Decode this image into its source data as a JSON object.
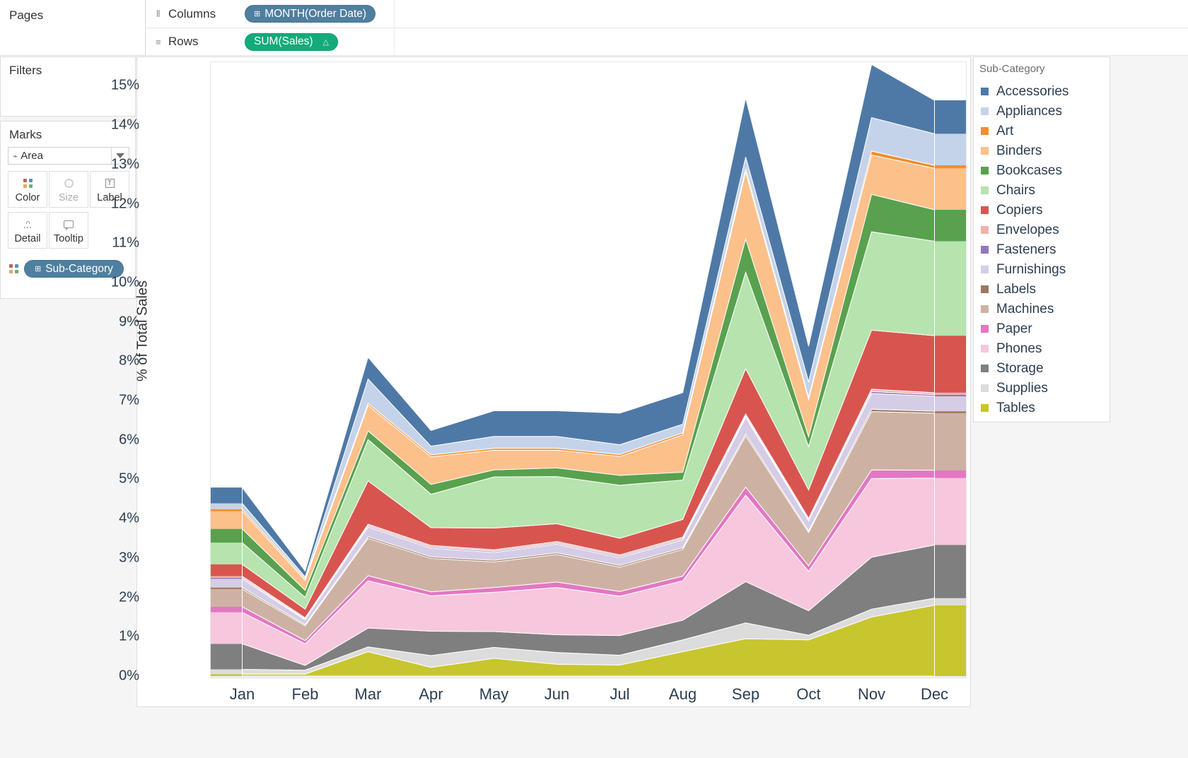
{
  "shelves": {
    "pages_label": "Pages",
    "columns_label": "Columns",
    "rows_label": "Rows",
    "columns_icon": "columns-grid-icon",
    "rows_icon": "rows-list-icon",
    "columns_pill": "MONTH(Order Date)",
    "rows_pill": "SUM(Sales)",
    "pill_dim_glyph": "⊞",
    "rows_sort_glyph": "△"
  },
  "filters": {
    "title": "Filters"
  },
  "marks": {
    "title": "Marks",
    "mark_type": "Area",
    "mark_type_icon": "area-chart-icon",
    "buttons": [
      {
        "label": "Color",
        "icon": "color-dots-icon",
        "disabled": false
      },
      {
        "label": "Size",
        "icon": "size-circle-icon",
        "disabled": true
      },
      {
        "label": "Label",
        "icon": "label-text-icon",
        "disabled": false
      },
      {
        "label": "Detail",
        "icon": "detail-dots-icon",
        "disabled": false
      },
      {
        "label": "Tooltip",
        "icon": "tooltip-bubble-icon",
        "disabled": false
      }
    ],
    "color_pill": "Sub-Category"
  },
  "legend": {
    "title": "Sub-Category",
    "items": [
      {
        "label": "Accessories",
        "color": "#4e79a7"
      },
      {
        "label": "Appliances",
        "color": "#c5d3ea"
      },
      {
        "label": "Art",
        "color": "#f28e2b"
      },
      {
        "label": "Binders",
        "color": "#fcc08b"
      },
      {
        "label": "Bookcases",
        "color": "#59a14f"
      },
      {
        "label": "Chairs",
        "color": "#b6e3ae"
      },
      {
        "label": "Copiers",
        "color": "#d8554f"
      },
      {
        "label": "Envelopes",
        "color": "#f5b0ab"
      },
      {
        "label": "Fasteners",
        "color": "#9275bd"
      },
      {
        "label": "Furnishings",
        "color": "#d5cde6"
      },
      {
        "label": "Labels",
        "color": "#9d7660"
      },
      {
        "label": "Machines",
        "color": "#cdb2a4"
      },
      {
        "label": "Paper",
        "color": "#e377c2"
      },
      {
        "label": "Phones",
        "color": "#f7c7dd"
      },
      {
        "label": "Storage",
        "color": "#7f7f7f"
      },
      {
        "label": "Supplies",
        "color": "#dcdcdc"
      },
      {
        "label": "Tables",
        "color": "#c7c62f"
      }
    ]
  },
  "chart_data": {
    "type": "area",
    "title": "",
    "xlabel": "",
    "ylabel": "% of Total Sales",
    "ylim": [
      0,
      15.6
    ],
    "ytick_step": 1,
    "ytick_labels": [
      "15%",
      "14%",
      "13%",
      "12%",
      "11%",
      "10%",
      "9%",
      "8%",
      "7%",
      "6%",
      "5%",
      "4%",
      "3%",
      "2%",
      "1%",
      "0%"
    ],
    "categories": [
      "Jan",
      "Feb",
      "Mar",
      "Apr",
      "May",
      "Jun",
      "Jul",
      "Aug",
      "Sep",
      "Oct",
      "Nov",
      "Dec"
    ],
    "stacked": true,
    "grid": false,
    "legend_position": "right",
    "totals": [
      4.1,
      2.55,
      8.65,
      6.0,
      6.4,
      6.35,
      6.45,
      6.95,
      13.45,
      8.35,
      15.2,
      14.2
    ],
    "series": [
      {
        "name": "Tables",
        "color": "#c7c62f",
        "values": [
          0.05,
          0.05,
          0.62,
          0.22,
          0.45,
          0.3,
          0.28,
          0.62,
          0.95,
          0.92,
          1.5,
          1.8
        ]
      },
      {
        "name": "Supplies",
        "color": "#dcdcdc",
        "values": [
          0.12,
          0.1,
          0.12,
          0.3,
          0.28,
          0.3,
          0.25,
          0.3,
          0.4,
          0.12,
          0.2,
          0.18
        ]
      },
      {
        "name": "Storage",
        "color": "#7f7f7f",
        "values": [
          0.65,
          0.12,
          0.48,
          0.62,
          0.4,
          0.45,
          0.5,
          0.5,
          1.05,
          0.62,
          1.32,
          1.35
        ]
      },
      {
        "name": "Phones",
        "color": "#f7c7dd",
        "values": [
          0.8,
          0.55,
          1.2,
          0.9,
          1.0,
          1.2,
          1.0,
          1.0,
          2.2,
          1.0,
          2.0,
          1.7
        ]
      },
      {
        "name": "Paper",
        "color": "#e377c2",
        "values": [
          0.14,
          0.08,
          0.13,
          0.1,
          0.12,
          0.14,
          0.12,
          0.12,
          0.2,
          0.14,
          0.22,
          0.2
        ]
      },
      {
        "name": "Machines",
        "color": "#cdb2a4",
        "values": [
          0.45,
          0.38,
          0.95,
          0.85,
          0.65,
          0.7,
          0.62,
          0.68,
          1.3,
          0.85,
          1.48,
          1.45
        ]
      },
      {
        "name": "Labels",
        "color": "#9d7660",
        "values": [
          0.04,
          0.03,
          0.04,
          0.04,
          0.04,
          0.04,
          0.04,
          0.04,
          0.05,
          0.04,
          0.06,
          0.05
        ]
      },
      {
        "name": "Furnishings",
        "color": "#d5cde6",
        "values": [
          0.22,
          0.12,
          0.25,
          0.22,
          0.2,
          0.22,
          0.2,
          0.2,
          0.42,
          0.25,
          0.4,
          0.38
        ]
      },
      {
        "name": "Fasteners",
        "color": "#9275bd",
        "values": [
          0.03,
          0.02,
          0.03,
          0.03,
          0.03,
          0.03,
          0.03,
          0.03,
          0.04,
          0.03,
          0.05,
          0.04
        ]
      },
      {
        "name": "Envelopes",
        "color": "#f5b0ab",
        "values": [
          0.04,
          0.03,
          0.04,
          0.04,
          0.04,
          0.04,
          0.04,
          0.04,
          0.05,
          0.04,
          0.06,
          0.05
        ]
      },
      {
        "name": "Copiers",
        "color": "#d8554f",
        "values": [
          0.3,
          0.22,
          1.1,
          0.45,
          0.55,
          0.45,
          0.42,
          0.45,
          1.15,
          0.72,
          1.5,
          1.45
        ]
      },
      {
        "name": "Chairs",
        "color": "#b6e3ae",
        "values": [
          0.55,
          0.3,
          1.05,
          0.85,
          1.3,
          1.2,
          1.35,
          1.0,
          2.45,
          1.1,
          2.5,
          2.4
        ]
      },
      {
        "name": "Bookcases",
        "color": "#59a14f",
        "values": [
          0.35,
          0.18,
          0.22,
          0.25,
          0.18,
          0.22,
          0.25,
          0.2,
          0.85,
          0.25,
          0.95,
          0.8
        ]
      },
      {
        "name": "Binders",
        "color": "#fcc08b",
        "values": [
          0.45,
          0.25,
          0.65,
          0.7,
          0.5,
          0.45,
          0.48,
          0.95,
          1.7,
          0.95,
          1.0,
          1.05
        ]
      },
      {
        "name": "Art",
        "color": "#f28e2b",
        "values": [
          0.05,
          0.04,
          0.05,
          0.05,
          0.05,
          0.05,
          0.05,
          0.05,
          0.08,
          0.05,
          0.1,
          0.08
        ]
      },
      {
        "name": "Appliances",
        "color": "#c5d3ea",
        "values": [
          0.15,
          0.05,
          0.62,
          0.22,
          0.3,
          0.3,
          0.25,
          0.22,
          0.3,
          0.4,
          0.85,
          0.8
        ]
      },
      {
        "name": "Accessories",
        "color": "#4e79a7",
        "values": [
          0.4,
          0.15,
          0.55,
          0.4,
          0.65,
          0.65,
          0.8,
          0.8,
          1.5,
          0.9,
          1.35,
          0.85
        ]
      }
    ]
  }
}
